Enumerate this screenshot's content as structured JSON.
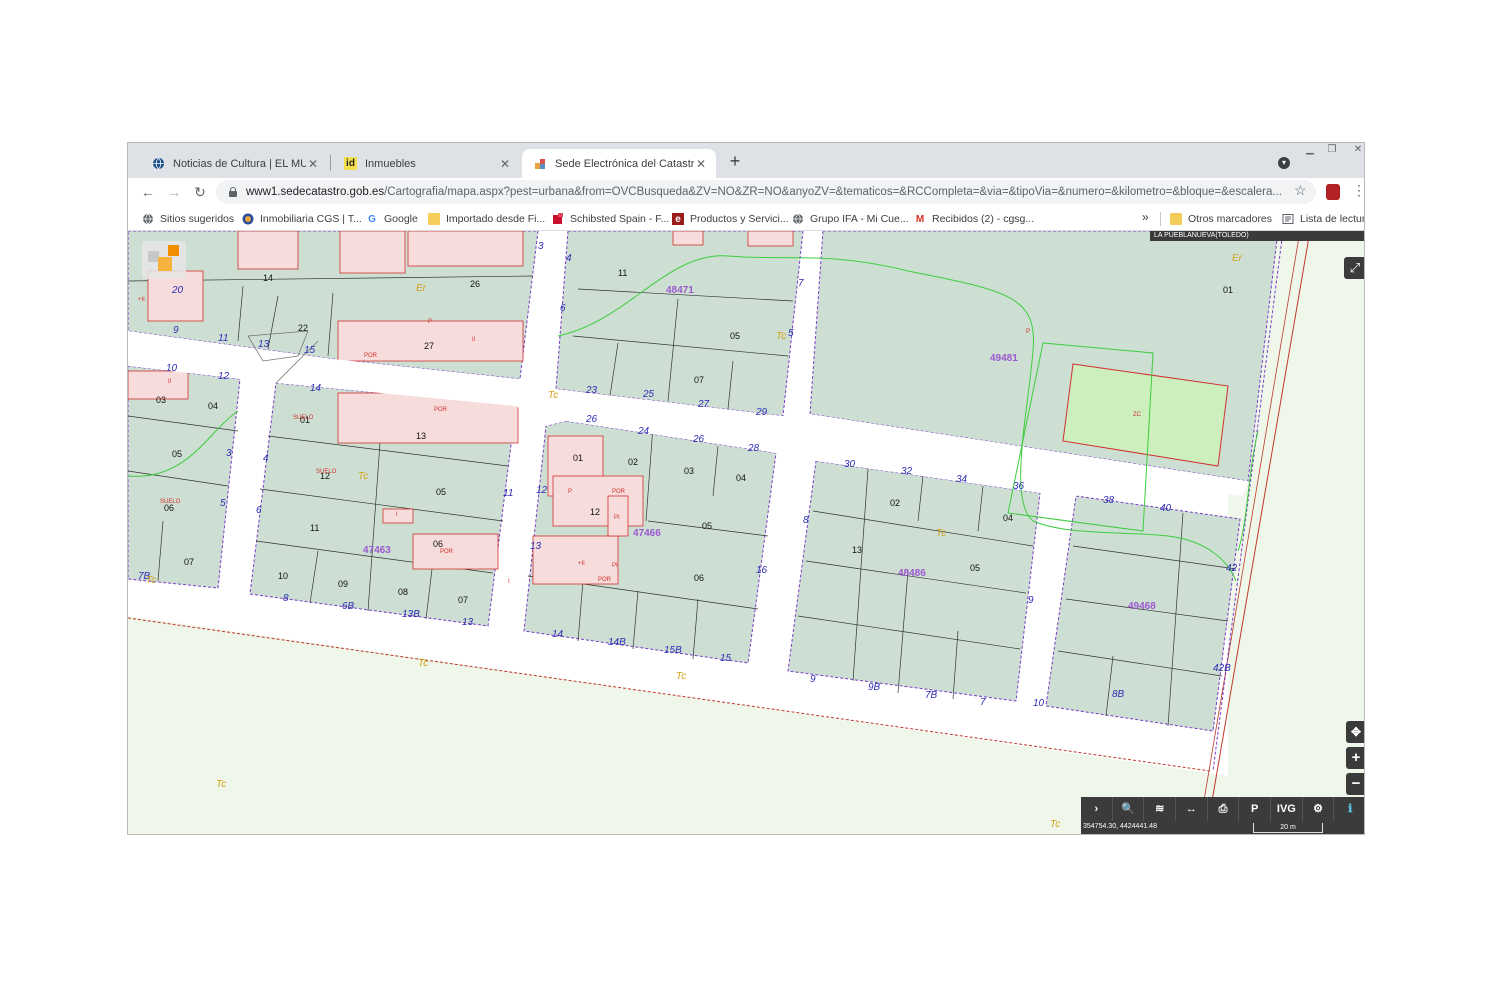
{
  "browser": {
    "tabs": [
      {
        "label": "Noticias de Cultura | EL MUNDO",
        "icon": "globe-icon",
        "active": false
      },
      {
        "label": "Inmuebles",
        "icon": "id-icon",
        "icon_text": "id",
        "active": false
      },
      {
        "label": "Sede Electrónica del Catastro - F",
        "icon": "catastro-icon",
        "active": true
      }
    ],
    "close_glyph": "✕",
    "new_tab_glyph": "+",
    "url_host": "www1.sedecatastro.gob.es",
    "url_path": "/Cartografia/mapa.aspx?pest=urbana&from=OVCBusqueda&ZV=NO&ZR=NO&anyoZV=&tematicos=&RCCompleta=&via=&tipoVia=&numero=&kilometro=&bloque=&escalera...",
    "bookmarks": [
      {
        "label": "Sitios sugeridos",
        "icon": "globe-icon"
      },
      {
        "label": "Inmobiliaria CGS | T...",
        "icon": "cgs-icon"
      },
      {
        "label": "Google",
        "icon": "google-icon",
        "icon_text": "G"
      },
      {
        "label": "Importado desde Fi...",
        "icon": "folder-icon"
      },
      {
        "label": "Schibsted Spain - F...",
        "icon": "schibsted-icon"
      },
      {
        "label": "Productos y Servici...",
        "icon": "productos-icon",
        "icon_text": "e"
      },
      {
        "label": "Grupo IFA - Mi Cue...",
        "icon": "globe-icon"
      },
      {
        "label": "Recibidos (2) - cgsg...",
        "icon": "gmail-icon",
        "icon_text": "M"
      }
    ],
    "bookmarks_more": "»",
    "other_bookmarks": "Otros marcadores",
    "reading_list": "Lista de lectura"
  },
  "map": {
    "location": "LA PUEBLANUEVA(TOLEDO)",
    "coordinates": "354754.30, 4424441.48",
    "scale": "20 m",
    "tools": [
      "›",
      "🔍",
      "≋",
      "↔",
      "⎙",
      "P",
      "IVG",
      "⚙",
      "ℹ"
    ],
    "zoom_in": "+",
    "zoom_out": "−",
    "locate": "✥",
    "fullscreen": "⤢",
    "parcels": [
      {
        "label": "48471"
      },
      {
        "label": "49481"
      },
      {
        "label": "47463"
      },
      {
        "label": "47466"
      },
      {
        "label": "48486"
      },
      {
        "label": "49468"
      }
    ],
    "street_numbers": [
      "20",
      "9",
      "11",
      "13",
      "15",
      "10",
      "12",
      "14",
      "26",
      "24",
      "26",
      "28",
      "30",
      "32",
      "34",
      "36",
      "38",
      "40",
      "8",
      "6B",
      "13B",
      "13",
      "14",
      "14B",
      "15B",
      "15",
      "9",
      "9B",
      "7B",
      "7",
      "8B",
      "25",
      "27",
      "29",
      "23",
      "42",
      "42B",
      "7B",
      "5",
      "6",
      "4",
      "3",
      "3",
      "4",
      "5",
      "6",
      "7",
      "8",
      "9",
      "10",
      "11",
      "12",
      "13",
      "16"
    ],
    "subparcels": [
      "01",
      "02",
      "03",
      "04",
      "05",
      "06",
      "07",
      "08",
      "09",
      "10",
      "11",
      "12",
      "13",
      "14",
      "22",
      "26",
      "27"
    ],
    "land_use_tags": [
      "Tc",
      "Er",
      "ZC",
      "SUELO",
      "POR",
      "P",
      "I",
      "II",
      "PI",
      "+II"
    ]
  }
}
